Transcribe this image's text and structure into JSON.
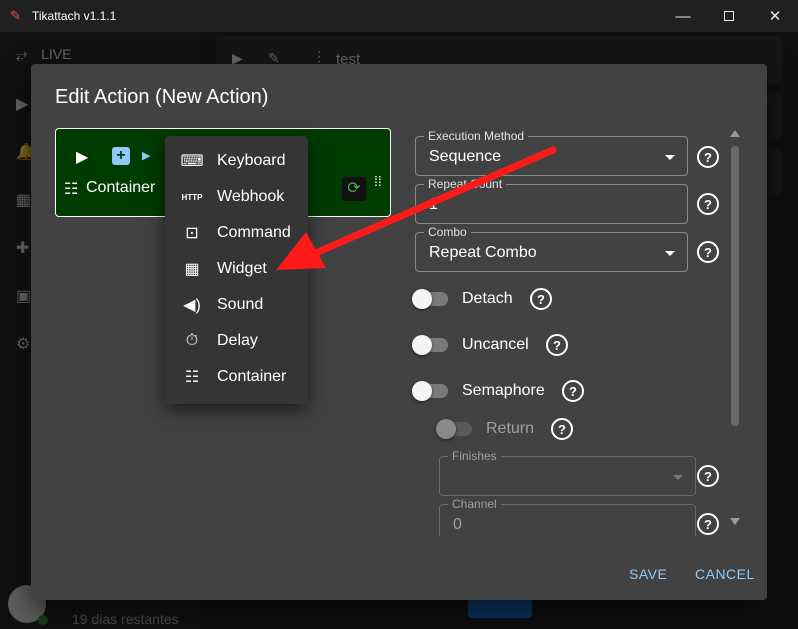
{
  "window": {
    "title": "Tikattach v1.1.1"
  },
  "sidebar": {
    "live_label": "LIVE",
    "user_days": "19 dias restantes"
  },
  "background_row": {
    "name": "test"
  },
  "dialog": {
    "title": "Edit Action (New Action)",
    "save_label": "SAVE",
    "cancel_label": "CANCEL"
  },
  "action_block": {
    "container_label": "Container"
  },
  "menu": {
    "items": [
      {
        "label": "Keyboard",
        "icon": "keyboard-icon"
      },
      {
        "label": "Webhook",
        "icon": "http-icon"
      },
      {
        "label": "Command",
        "icon": "terminal-icon"
      },
      {
        "label": "Widget",
        "icon": "widgets-icon"
      },
      {
        "label": "Sound",
        "icon": "volume-icon"
      },
      {
        "label": "Delay",
        "icon": "timer-icon"
      },
      {
        "label": "Container",
        "icon": "list-icon"
      }
    ]
  },
  "form": {
    "execution_method": {
      "label": "Execution Method",
      "value": "Sequence"
    },
    "repeat_count": {
      "label": "Repeat Count",
      "value": "1"
    },
    "combo": {
      "label": "Combo",
      "value": "Repeat Combo"
    },
    "detach_label": "Detach",
    "uncancel_label": "Uncancel",
    "semaphore_label": "Semaphore",
    "return_label": "Return",
    "finishes": {
      "label": "Finishes",
      "value": ""
    },
    "channel": {
      "label": "Channel",
      "value": "0"
    }
  },
  "colors": {
    "accent": "#90caf9",
    "action_green": "#003b00",
    "arrow_red": "#ff1a1a"
  }
}
